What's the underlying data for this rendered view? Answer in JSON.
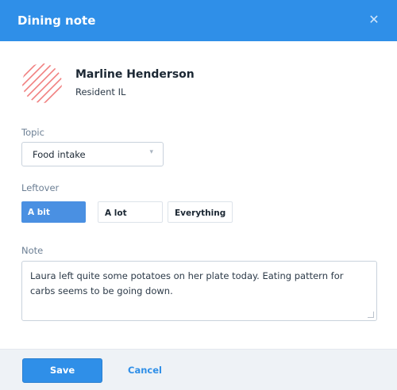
{
  "dialog": {
    "title": "Dining note",
    "close_icon": "close-icon"
  },
  "resident": {
    "name": "Marline Henderson",
    "role": "Resident IL",
    "avatar_icon": "avatar-placeholder-icon"
  },
  "topic": {
    "label": "Topic",
    "value": "Food intake",
    "chevron_icon": "chevron-down-icon"
  },
  "leftover": {
    "label": "Leftover",
    "options": [
      "A bit",
      "A lot",
      "Everything"
    ],
    "selected": "A bit"
  },
  "note": {
    "label": "Note",
    "text": "Laura left quite some potatoes on her plate today. Eating pattern for carbs seems to be going down."
  },
  "footer": {
    "save_label": "Save",
    "cancel_label": "Cancel"
  },
  "colors": {
    "header_bg": "#2f8fe8",
    "primary": "#2f8fe8",
    "selected_segment": "#4a90e2",
    "avatar_stripes": "#f07f7f",
    "footer_bg": "#eef2f6"
  }
}
